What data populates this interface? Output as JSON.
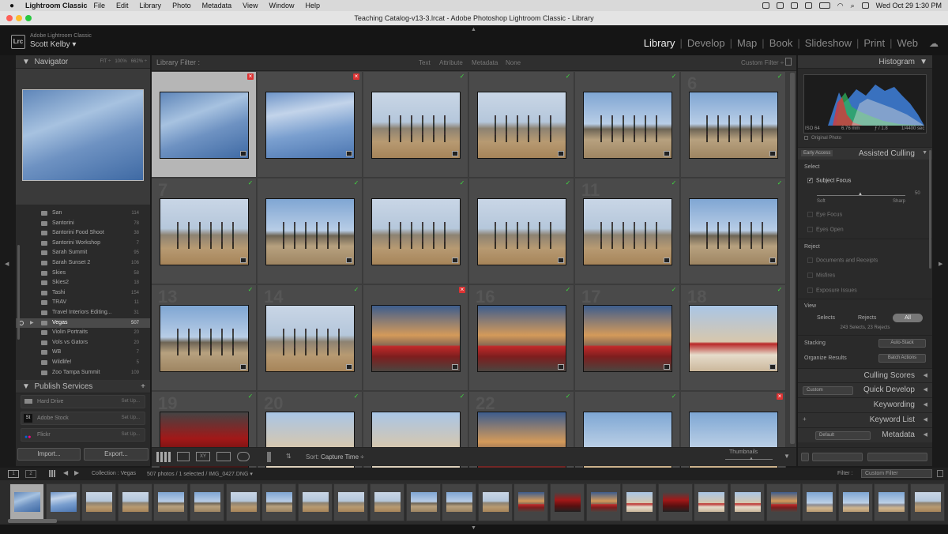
{
  "menubar": {
    "app": "Lightroom Classic",
    "items": [
      "File",
      "Edit",
      "Library",
      "Photo",
      "Metadata",
      "View",
      "Window",
      "Help"
    ],
    "clock": "Wed Oct 29  1:30 PM"
  },
  "window": {
    "title": "Teaching Catalog-v13-3.lrcat - Adobe Photoshop Lightroom Classic - Library"
  },
  "identity": {
    "product": "Adobe Lightroom Classic",
    "user": "Scott Kelby ▾"
  },
  "modules": [
    {
      "label": "Library",
      "active": true
    },
    {
      "label": "Develop"
    },
    {
      "label": "Map"
    },
    {
      "label": "Book"
    },
    {
      "label": "Slideshow"
    },
    {
      "label": "Print"
    },
    {
      "label": "Web"
    }
  ],
  "left": {
    "navigator_title": "Navigator",
    "nav_zoom": [
      "FIT ÷",
      "100%",
      "662% ÷"
    ],
    "folders": [
      {
        "name": "San",
        "count": "114"
      },
      {
        "name": "Santorini",
        "count": "78"
      },
      {
        "name": "Santorini Food Shoot",
        "count": "38"
      },
      {
        "name": "Santorini Workshop",
        "count": "7"
      },
      {
        "name": "Sarah Summit",
        "count": "95"
      },
      {
        "name": "Sarah Sunset 2",
        "count": "106"
      },
      {
        "name": "Skies",
        "count": "58"
      },
      {
        "name": "Skies2",
        "count": "18"
      },
      {
        "name": "Tashi",
        "count": "154"
      },
      {
        "name": "TRAV",
        "count": "11"
      },
      {
        "name": "Travel Interiors Editing...",
        "count": "31"
      },
      {
        "name": "Vegas",
        "count": "507",
        "selected": true
      },
      {
        "name": "Violin Portraits",
        "count": "20"
      },
      {
        "name": "Vols vs Gators",
        "count": "20"
      },
      {
        "name": "WB",
        "count": "7"
      },
      {
        "name": "Wildlife!",
        "count": "5"
      },
      {
        "name": "Zoo Tampa Summit",
        "count": "109"
      }
    ],
    "publish_title": "Publish Services",
    "publish": [
      {
        "name": "Hard Drive",
        "action": "Set Up..."
      },
      {
        "name": "Adobe Stock",
        "action": "Set Up..."
      },
      {
        "name": "Flickr",
        "action": "Set Up..."
      }
    ],
    "import_label": "Import...",
    "export_label": "Export..."
  },
  "grid": {
    "filter_title": "Library Filter :",
    "filter_tabs": [
      "Text",
      "Attribute",
      "Metadata",
      "None"
    ],
    "custom_filter": "Custom Filter ÷",
    "cells": [
      {
        "num": "",
        "flag": "reject",
        "img": "sky",
        "selected": true
      },
      {
        "num": "",
        "flag": "reject",
        "img": "sky2"
      },
      {
        "num": "",
        "flag": "pick",
        "img": "desert"
      },
      {
        "num": "",
        "flag": "pick",
        "img": "desert"
      },
      {
        "num": "",
        "flag": "pick",
        "img": "desert2"
      },
      {
        "num": "6",
        "flag": "pick",
        "img": "desert2"
      },
      {
        "num": "7",
        "flag": "pick",
        "img": "desert"
      },
      {
        "num": "",
        "flag": "pick",
        "img": "desert2"
      },
      {
        "num": "",
        "flag": "pick",
        "img": "desert"
      },
      {
        "num": "",
        "flag": "pick",
        "img": "desert"
      },
      {
        "num": "11",
        "flag": "pick",
        "img": "desert"
      },
      {
        "num": "",
        "flag": "pick",
        "img": "desert2"
      },
      {
        "num": "13",
        "flag": "pick",
        "img": "desert2"
      },
      {
        "num": "14",
        "flag": "pick",
        "img": "desert"
      },
      {
        "num": "",
        "flag": "reject",
        "img": "car"
      },
      {
        "num": "16",
        "flag": "pick",
        "img": "car"
      },
      {
        "num": "17",
        "flag": "pick",
        "img": "car"
      },
      {
        "num": "18",
        "flag": "pick",
        "img": "car2"
      },
      {
        "num": "19",
        "flag": "pick",
        "img": "red"
      },
      {
        "num": "20",
        "flag": "pick",
        "img": "car2"
      },
      {
        "num": "",
        "flag": "pick",
        "img": "car2"
      },
      {
        "num": "22",
        "flag": "pick",
        "img": "car"
      },
      {
        "num": "",
        "flag": "pick",
        "img": "mtn"
      },
      {
        "num": "",
        "flag": "reject",
        "img": "mtn"
      }
    ],
    "sort_label": "Sort:",
    "sort_value": "Capture Time ÷",
    "thumbnails_label": "Thumbnails"
  },
  "right": {
    "histogram_title": "Histogram",
    "hist_info": [
      "ISO 64",
      "6.76 mm",
      "ƒ / 1.8",
      "1/4400 sec"
    ],
    "original_photo": "Original Photo",
    "early_access": "Early Access",
    "assisted_culling": "Assisted Culling",
    "select_label": "Select",
    "subject_focus": "Subject Focus",
    "soft": "Soft",
    "sharp": "Sharp",
    "slider_value": "50",
    "eye_focus": "Eye Focus",
    "eyes_open": "Eyes Open",
    "reject_label": "Reject",
    "reject_items": [
      "Documents and Receipts",
      "Misfires",
      "Exposure Issues"
    ],
    "view_label": "View",
    "view_opts": [
      "Selects",
      "Rejects",
      "All"
    ],
    "view_summary": "243 Selects, 23 Rejects",
    "stacking": "Stacking",
    "auto_stack": "Auto-Stack",
    "organize": "Organize Results",
    "batch_actions": "Batch Actions",
    "culling_scores": "Culling Scores",
    "quick_develop": "Quick Develop",
    "custom": "Custom",
    "keywording": "Keywording",
    "keyword_list": "Keyword List",
    "metadata": "Metadata",
    "default": "Default"
  },
  "filmstrip": {
    "collection": "Collection : Vegas",
    "summary": "507 photos / 1 selected / IMG_0427.DNG ▾",
    "filter_label": "Filter :",
    "filter_value": "Custom Filter",
    "thumbs": [
      "sky",
      "sky2",
      "desert",
      "desert",
      "desert2",
      "desert2",
      "desert",
      "desert2",
      "desert",
      "desert",
      "desert",
      "desert2",
      "desert2",
      "desert",
      "car",
      "red",
      "car",
      "car2",
      "red",
      "car2",
      "car2",
      "car",
      "mtn",
      "mtn",
      "mtn",
      "desert"
    ]
  }
}
